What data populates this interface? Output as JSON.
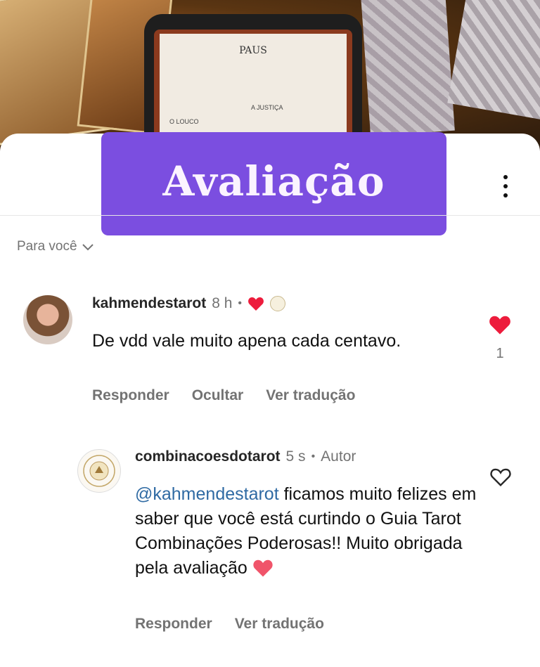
{
  "banner": {
    "title": "Avaliação"
  },
  "header": {
    "menu_icon": "kebab-icon"
  },
  "background": {
    "phone_screen_title": "PAUS",
    "card_label_1": "O LOUCO",
    "card_label_2": "A JUSTIÇA"
  },
  "filter": {
    "label": "Para você",
    "icon": "chevron-down-icon"
  },
  "comments": [
    {
      "username": "kahmendestarot",
      "time": "8 h",
      "separator": "•",
      "text": "De vdd vale muito apena cada centavo.",
      "actions": [
        "Responder",
        "Ocultar",
        "Ver tradução"
      ],
      "like_count": "1",
      "liked": true
    },
    {
      "username": "combinacoesdotarot",
      "time": "5 s",
      "separator": "•",
      "badge": "Autor",
      "mention": "@kahmendestarot",
      "text": " ficamos muito felizes em saber que você está curtindo o Guia Tarot Combinações Poderosas!! Muito obrigada pela avaliação",
      "actions": [
        "Responder",
        "Ver tradução"
      ],
      "liked": false
    }
  ],
  "colors": {
    "accent": "#7b4ee0",
    "like": "#ed1c3c",
    "mention": "#2f6aa3",
    "muted": "#737373"
  }
}
